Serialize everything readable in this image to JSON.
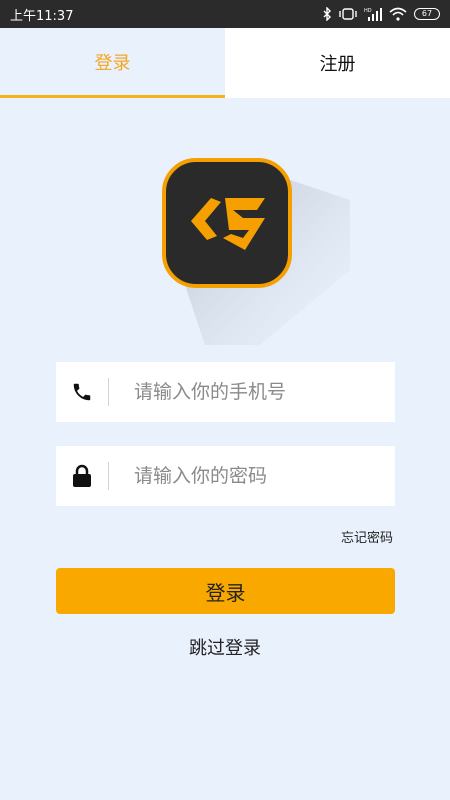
{
  "status_bar": {
    "time": "上午11:37",
    "battery": "67",
    "network_label": "HD"
  },
  "tabs": [
    {
      "label": "登录",
      "active": true
    },
    {
      "label": "注册",
      "active": false
    }
  ],
  "form": {
    "phone_placeholder": "请输入你的手机号",
    "password_placeholder": "请输入你的密码",
    "forgot_label": "忘记密码",
    "login_label": "登录",
    "skip_label": "跳过登录"
  },
  "colors": {
    "accent": "#f9a800",
    "background": "#e9f1fd",
    "logo_bg": "#2a2a2a"
  },
  "icons": [
    "bluetooth-icon",
    "signal-icon",
    "wifi-icon",
    "battery-icon",
    "phone-icon",
    "lock-icon",
    "app-logo-icon"
  ]
}
